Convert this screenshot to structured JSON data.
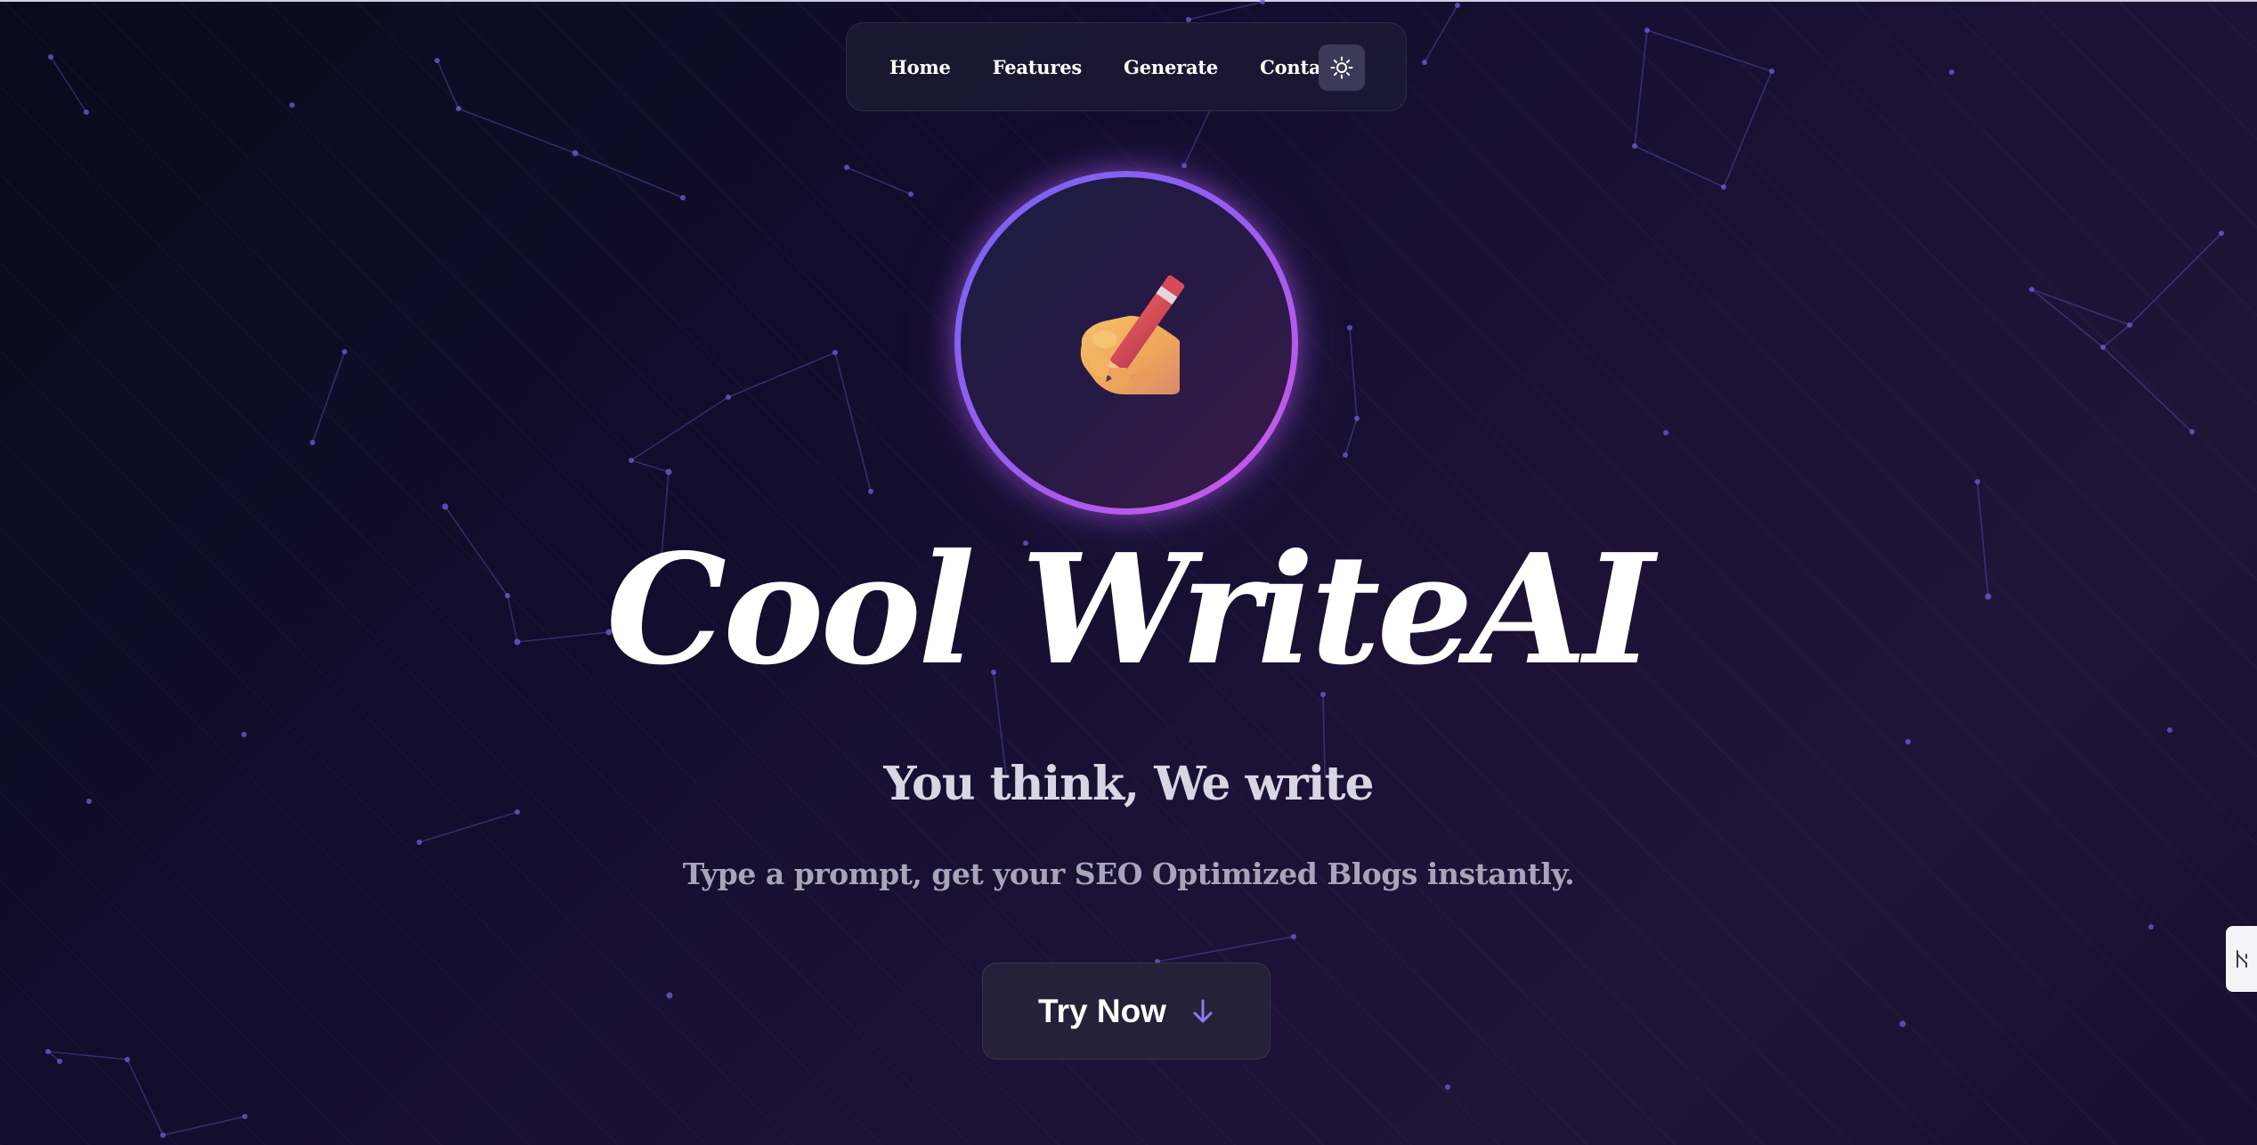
{
  "nav": {
    "links": [
      "Home",
      "Features",
      "Generate",
      "Contact"
    ],
    "theme_toggle_icon": "sun-icon"
  },
  "hero": {
    "logo_icon": "writing-hand-emoji",
    "brand": "Cool WriteAI",
    "tagline": "You think, We write",
    "subtitle": "Type a prompt, get your SEO Optimized Blogs instantly.",
    "cta_label": "Try Now",
    "cta_icon": "arrow-down-icon"
  },
  "side_tab_icon": "extension-tab-icon",
  "colors": {
    "background": "#120d2c",
    "ring_start": "#7166f4",
    "ring_end": "#d356e8",
    "accent": "#8b7bf0"
  }
}
